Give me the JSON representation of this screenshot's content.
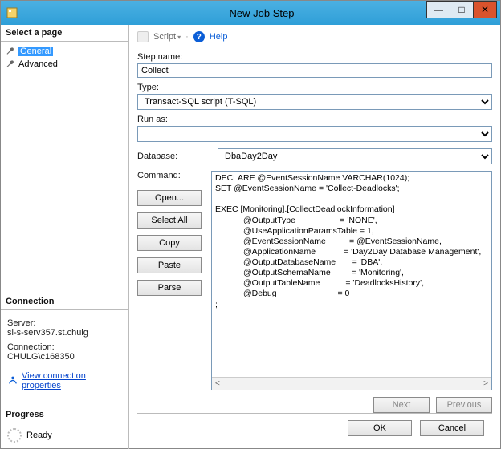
{
  "window": {
    "title": "New Job Step",
    "min": "—",
    "max": "□",
    "close": "✕"
  },
  "leftpane": {
    "select_page": "Select a page",
    "pages": {
      "general": "General",
      "advanced": "Advanced"
    },
    "connection_head": "Connection",
    "server_label": "Server:",
    "server_value": "si-s-serv357.st.chulg",
    "conn_label": "Connection:",
    "conn_value": "CHULG\\c168350",
    "view_props": "View connection properties",
    "progress_head": "Progress",
    "progress_status": "Ready"
  },
  "toolbar": {
    "script": "Script",
    "help": "Help"
  },
  "form": {
    "step_name_label": "Step name:",
    "step_name_value": "Collect",
    "type_label": "Type:",
    "type_value": "Transact-SQL script (T-SQL)",
    "runas_label": "Run as:",
    "runas_value": "",
    "database_label": "Database:",
    "database_value": "DbaDay2Day",
    "command_label": "Command:"
  },
  "buttons": {
    "open": "Open...",
    "select_all": "Select All",
    "copy": "Copy",
    "paste": "Paste",
    "parse": "Parse",
    "next": "Next",
    "previous": "Previous",
    "ok": "OK",
    "cancel": "Cancel"
  },
  "command_text": "DECLARE @EventSessionName VARCHAR(1024);\nSET @EventSessionName = 'Collect-Deadlocks';\n\nEXEC [Monitoring].[CollectDeadlockInformation]\n            @OutputType                   = 'NONE',\n            @UseApplicationParamsTable = 1,\n            @EventSessionName          = @EventSessionName,\n            @ApplicationName            = 'Day2Day Database Management',\n            @OutputDatabaseName       = 'DBA',\n            @OutputSchemaName         = 'Monitoring',\n            @OutputTableName           = 'DeadlocksHistory',\n            @Debug                          = 0\n;"
}
